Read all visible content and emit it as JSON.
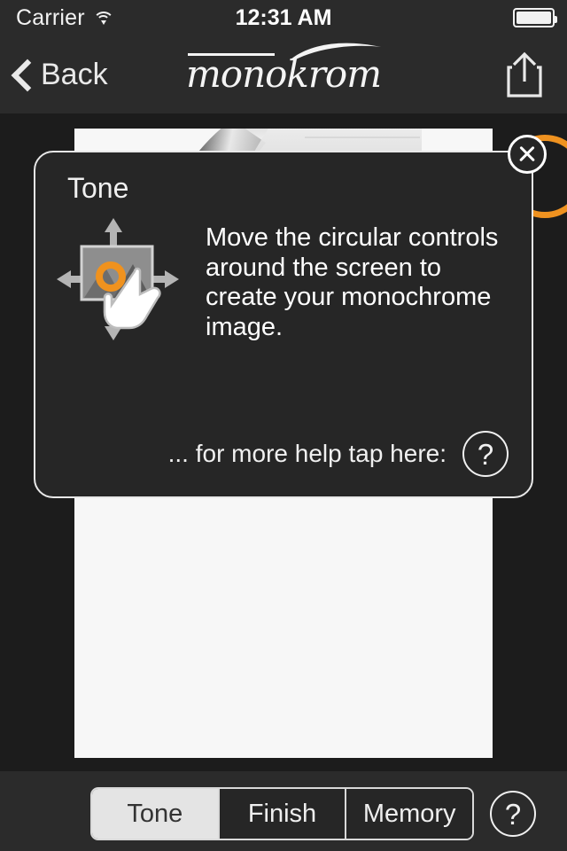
{
  "status_bar": {
    "carrier": "Carrier",
    "wifi_icon": "wifi-icon",
    "time": "12:31 AM",
    "battery_icon": "battery-full-icon"
  },
  "nav_bar": {
    "back_label": "Back",
    "back_icon": "chevron-left-icon",
    "brand": "monokrom",
    "share_icon": "share-up-icon"
  },
  "canvas": {
    "photo_description": "black and white close-up of a hammer head",
    "tone_control_color": "#0A78EE",
    "finish_control_color": "#EF9220",
    "background": "#F7F7F7"
  },
  "help_modal": {
    "title": "Tone",
    "glyph_icon": "move-photo-touch-icon",
    "body": "Move the circular controls around the screen to create your monochrome image.",
    "help_prompt": "... for more help tap here:",
    "help_icon_label": "?",
    "close_icon": "close-x-icon"
  },
  "tab_bar": {
    "segments": [
      {
        "label": "Tone",
        "active": true
      },
      {
        "label": "Finish",
        "active": false
      },
      {
        "label": "Memory",
        "active": false
      }
    ],
    "help_icon_label": "?"
  }
}
